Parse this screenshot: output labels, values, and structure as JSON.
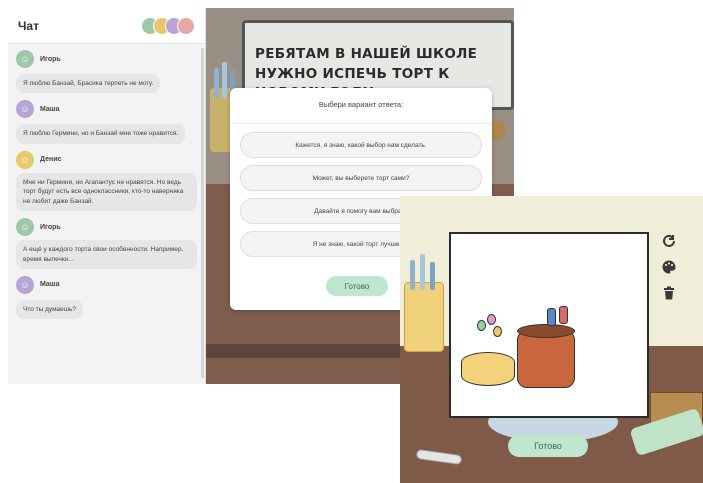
{
  "chat": {
    "title": "Чат",
    "messages": [
      {
        "name": "Игорь",
        "text": "Я люблю Банзай, Брасика терпеть не могу.",
        "color": "#9ec9a8"
      },
      {
        "name": "Маша",
        "text": "Я люблю Гермини, но и Банзай мне тоже нравится.",
        "color": "#b7a4d6"
      },
      {
        "name": "Денис",
        "text": "Мне ни Гермини, ни Агапантус не нравятся. Но ведь торт будут есть все одноклассники, кто-то наверняка не любит даже Банзай.",
        "color": "#e9c76b"
      },
      {
        "name": "Игорь",
        "text": "А ещё у каждого торта свои особенности. Например, время выпечки...",
        "color": "#9ec9a8"
      },
      {
        "name": "Маша",
        "text": "Что ты думаешь?",
        "color": "#b7a4d6"
      }
    ]
  },
  "scene1": {
    "board_text": "РЕБЯТАМ В НАШЕЙ ШКОЛЕ НУЖНО ИСПЕЧЬ ТОРТ К НОВОМУ ГОДУ.",
    "dialog": {
      "title": "Выбери вариант ответа:",
      "options": [
        "Кажется, я знаю, какой выбор нам сделать.",
        "Может, вы выберете торт сами?",
        "Давайте я помогу вам выбрать",
        "Я не знаю, какой торт лучше вы"
      ],
      "done_label": "Готово"
    }
  },
  "scene2": {
    "done_label": "Готово",
    "tools": [
      "refresh-icon",
      "palette-icon",
      "trash-icon"
    ]
  }
}
